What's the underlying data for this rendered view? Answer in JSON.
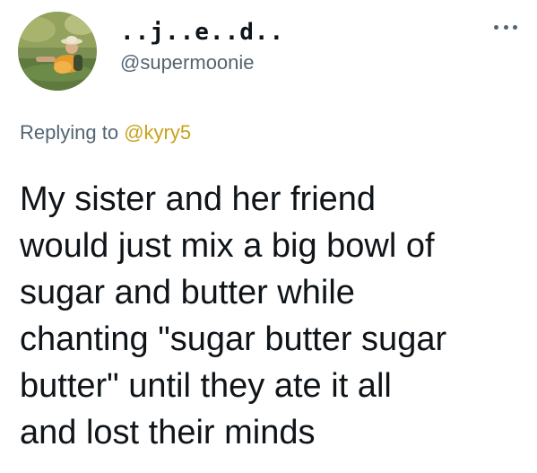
{
  "author": {
    "display_name": "..j..e..d..",
    "handle": "@supermoonie"
  },
  "more_icon": "ellipsis-icon",
  "reply": {
    "prefix": "Replying to ",
    "mention": "@kyry5",
    "mention_color": "#c8a21a"
  },
  "tweet": {
    "lines": [
      "My sister and her friend",
      "would just mix a big bowl of",
      "sugar and butter while",
      "chanting \"sugar butter sugar",
      "butter\" until they ate it all",
      "and lost their minds"
    ]
  },
  "colors": {
    "text": "#0f1419",
    "secondary": "#536471",
    "background": "#ffffff"
  }
}
